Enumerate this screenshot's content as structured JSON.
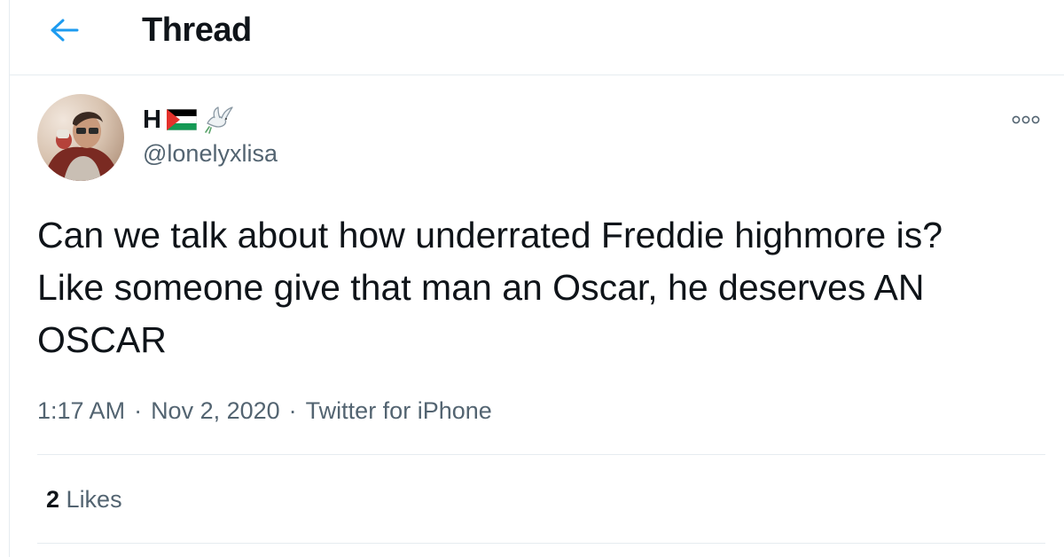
{
  "header": {
    "title": "Thread",
    "back_icon": "arrow-left-icon"
  },
  "colors": {
    "accent": "#1d9bf0",
    "text_primary": "#0f1419",
    "text_secondary": "#536471",
    "divider": "#e6ecf0"
  },
  "tweet": {
    "author": {
      "display_name": "H",
      "emoji_icons": [
        "palestine-flag-icon",
        "dove-icon"
      ],
      "handle": "@lonelyxlisa"
    },
    "text": "Can we talk about how underrated Freddie highmore is?\nLike someone give that man an Oscar, he deserves AN\nOSCAR",
    "meta": {
      "time": "1:17 AM",
      "separator": "·",
      "date": "Nov 2, 2020",
      "source": "Twitter for iPhone"
    },
    "stats": {
      "likes_count": "2",
      "likes_label": "Likes"
    }
  }
}
